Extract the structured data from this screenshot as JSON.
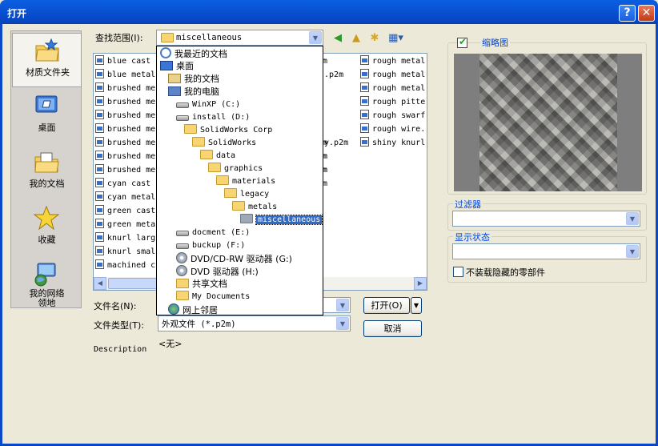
{
  "window": {
    "title": "打开",
    "help_glyph": "?",
    "close_glyph": "✕"
  },
  "places": [
    {
      "label": "材质文件夹",
      "icon": "folder-star-icon"
    },
    {
      "label": "桌面",
      "icon": "desktop-icon"
    },
    {
      "label": "我的文档",
      "icon": "my-documents-icon"
    },
    {
      "label": "收藏",
      "icon": "favorites-star-icon"
    },
    {
      "label": "我的网络\n领地",
      "icon": "network-places-icon"
    }
  ],
  "lookin": {
    "label": "查找范围(I):",
    "value": "miscellaneous"
  },
  "files_col1": [
    "blue cast",
    "blue metal",
    "brushed me",
    "brushed me",
    "brushed me",
    "brushed me",
    "brushed me",
    "brushed me",
    "brushed me",
    "cyan cast",
    "cyan metal",
    "green cast",
    "green metal",
    "knurl larg",
    "knurl smal",
    "machined c"
  ],
  "files_col2_fragments": [
    "m",
    "l.p2m",
    "m",
    "m",
    "m",
    "ey.p2m",
    "m",
    "m",
    "m"
  ],
  "files_col3": [
    "rough metal",
    "rough metal",
    "rough metal",
    "rough pitte",
    "rough swarf",
    "rough wire.",
    "shiny knurl"
  ],
  "dropdown_items": [
    {
      "label": "我最近的文档",
      "type": "recent",
      "indent": 0
    },
    {
      "label": "桌面",
      "type": "desktop",
      "indent": 0
    },
    {
      "label": "我的文档",
      "type": "docs",
      "indent": 1
    },
    {
      "label": "我的电脑",
      "type": "pc",
      "indent": 1
    },
    {
      "label": "WinXP (C:)",
      "type": "drive",
      "indent": 2
    },
    {
      "label": "install (D:)",
      "type": "drive",
      "indent": 2
    },
    {
      "label": "SolidWorks Corp",
      "type": "folder",
      "indent": 3
    },
    {
      "label": "SolidWorks",
      "type": "folder",
      "indent": 4
    },
    {
      "label": "data",
      "type": "folder",
      "indent": 5
    },
    {
      "label": "graphics",
      "type": "folder",
      "indent": 6
    },
    {
      "label": "materials",
      "type": "folder",
      "indent": 7
    },
    {
      "label": "legacy",
      "type": "folder",
      "indent": 8
    },
    {
      "label": "metals",
      "type": "folder",
      "indent": 9
    },
    {
      "label": "miscellaneous",
      "type": "folder-open",
      "indent": 10,
      "selected": true
    },
    {
      "label": "docment (E:)",
      "type": "drive",
      "indent": 2
    },
    {
      "label": "buckup (F:)",
      "type": "drive",
      "indent": 2
    },
    {
      "label": "DVD/CD-RW 驱动器 (G:)",
      "type": "cdrom",
      "indent": 2
    },
    {
      "label": "DVD 驱动器 (H:)",
      "type": "cdrom",
      "indent": 2
    },
    {
      "label": "共享文档",
      "type": "folder",
      "indent": 2
    },
    {
      "label": "My Documents",
      "type": "folder",
      "indent": 2
    },
    {
      "label": "网上邻居",
      "type": "net",
      "indent": 1
    }
  ],
  "filename": {
    "label": "文件名(N):",
    "value": ""
  },
  "filetype": {
    "label": "文件类型(T):",
    "value": "外观文件 (*.p2m)"
  },
  "buttons": {
    "open": "打开(O)",
    "cancel": "取消"
  },
  "description": {
    "label": "Description",
    "value": "<无>"
  },
  "thumbnail": {
    "label": "缩略图",
    "checked": true
  },
  "filter": {
    "label": "过滤器",
    "value": ""
  },
  "display_state": {
    "label": "显示状态",
    "value": ""
  },
  "hidden_parts": {
    "label": "不装载隐藏的零部件",
    "checked": false
  }
}
